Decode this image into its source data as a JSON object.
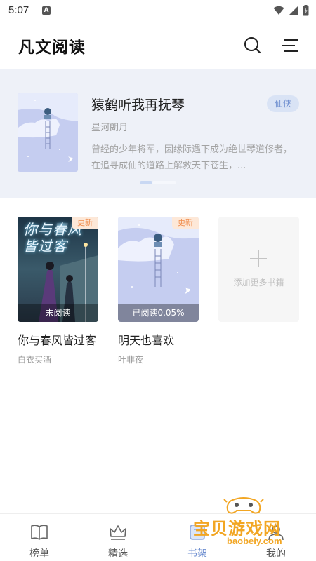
{
  "status_bar": {
    "time": "5:07",
    "a_badge": "A"
  },
  "header": {
    "title": "凡文阅读"
  },
  "banner": {
    "book_title": "猿鹤听我再抚琴",
    "author": "星河朗月",
    "description": "曾经的少年将军，因缘际遇下成为绝世琴道修者，在追寻成仙的道路上解救天下苍生，...",
    "tag": "仙侠",
    "tag_color": "#6f8fd0"
  },
  "shelf": {
    "books": [
      {
        "title": "你与春风皆过客",
        "author": "白衣买酒",
        "badge": "更新",
        "progress": "未阅读",
        "cover_text": "你与春风皆过客"
      },
      {
        "title": "明天也喜欢",
        "author": "叶非夜",
        "badge": "更新",
        "progress": "已阅读0.05%"
      }
    ],
    "add_label": "添加更多书籍"
  },
  "bottom_nav": {
    "items": [
      {
        "label": "榜单",
        "icon": "book-icon"
      },
      {
        "label": "精选",
        "icon": "crown-icon"
      },
      {
        "label": "书架",
        "icon": "bookshelf-icon",
        "active": true
      },
      {
        "label": "我的",
        "icon": "user-icon"
      }
    ]
  },
  "watermark": {
    "title": "宝贝游戏网",
    "url": "baobeiy.com"
  },
  "colors": {
    "accent": "#6f8fd0",
    "update_badge": "#f08c4c",
    "banner_bg": "#eef1f8"
  }
}
